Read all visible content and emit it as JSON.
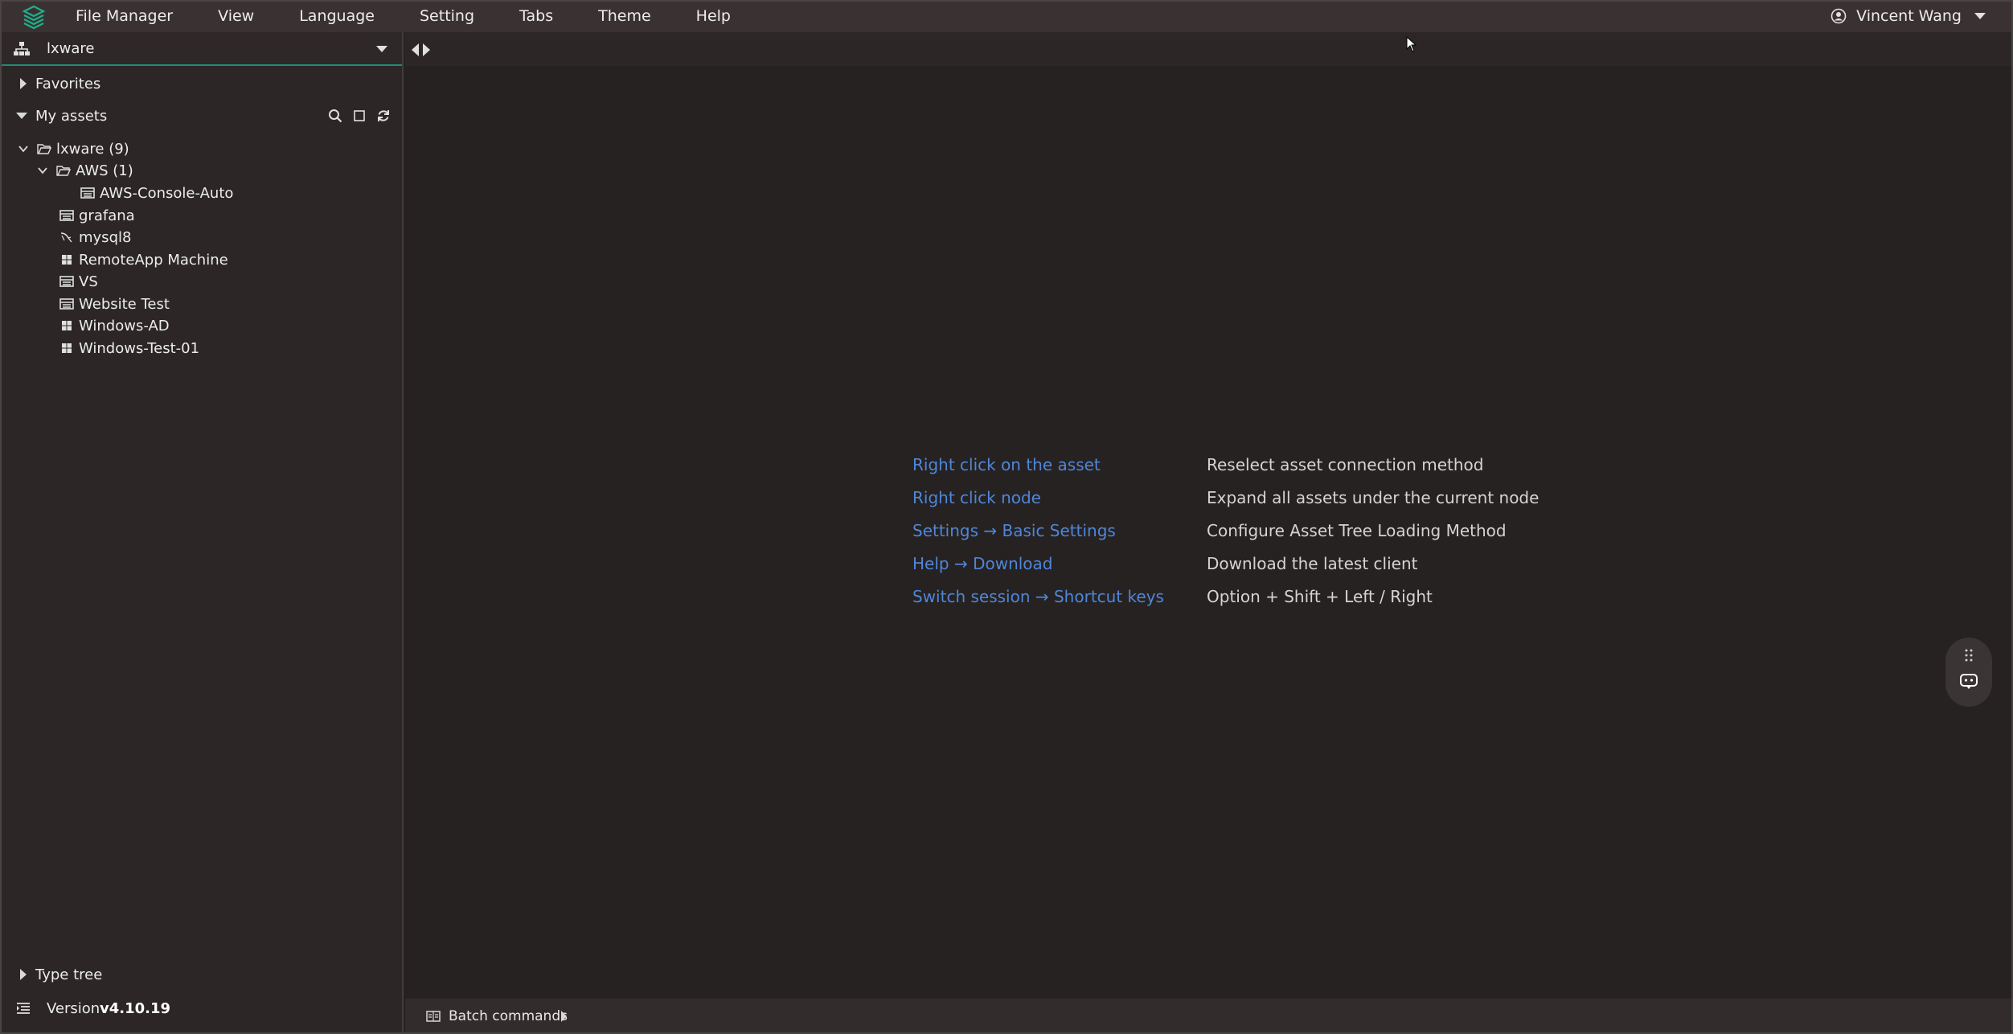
{
  "menubar": {
    "items": [
      "File Manager",
      "View",
      "Language",
      "Setting",
      "Tabs",
      "Theme",
      "Help"
    ],
    "user_name": "Vincent Wang"
  },
  "sidebar": {
    "org_name": "lxware",
    "favorites_label": "Favorites",
    "my_assets_label": "My assets",
    "tree": {
      "root": "lxware (9)",
      "aws_folder": "AWS (1)",
      "aws_child": "AWS-Console-Auto",
      "assets": [
        "grafana",
        "mysql8",
        "RemoteApp Machine",
        "VS",
        "Website Test",
        "Windows-AD",
        "Windows-Test-01"
      ]
    },
    "type_tree_label": "Type tree",
    "version_label": "Version",
    "version_number": "v4.10.19"
  },
  "tips": [
    {
      "key": "Right click on the asset",
      "desc": "Reselect asset connection method"
    },
    {
      "key": "Right click node",
      "desc": "Expand all assets under the current node"
    },
    {
      "key": "Settings → Basic Settings",
      "desc": "Configure Asset Tree Loading Method"
    },
    {
      "key": "Help → Download",
      "desc": "Download the latest client"
    },
    {
      "key": "Switch session → Shortcut keys",
      "desc": "Option + Shift + Left / Right"
    }
  ],
  "bottombar": {
    "batch_label": "Batch commands"
  },
  "colors": {
    "accent": "#1d8f73",
    "link": "#4f86d8",
    "background": "#262222",
    "menubar": "#3a3232"
  }
}
